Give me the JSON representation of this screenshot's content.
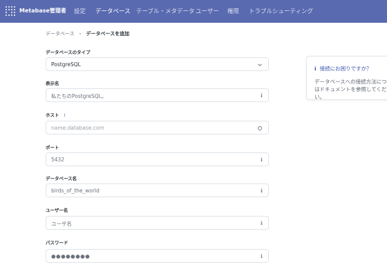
{
  "nav": {
    "brand": "Metabase管理者",
    "items": [
      "設定",
      "データベース",
      "テーブル・メタデータ",
      "ユーザー",
      "権限",
      "トラブルシューティング"
    ]
  },
  "breadcrumb": {
    "parent": "データベース",
    "separator": "›",
    "current": "データベースを追加"
  },
  "form": {
    "db_type": {
      "label": "データベースのタイプ",
      "value": "PostgreSQL"
    },
    "display_name": {
      "label": "表示名",
      "value": "私たちのPostgreSQL。"
    },
    "host": {
      "label": "ホスト",
      "info": "i",
      "placeholder": "name.database.com"
    },
    "port": {
      "label": "ポート",
      "value": "5432"
    },
    "db_name": {
      "label": "データベース名",
      "value": "birds_of_the_world"
    },
    "username": {
      "label": "ユーザー名",
      "value": "ユーザ名"
    },
    "password": {
      "label": "パスワード",
      "value": "●●●●●●●●"
    }
  },
  "help": {
    "title": "接続にお困りですか？",
    "text": "データベースへの接続方法についてはドキュメントを参照してください。"
  },
  "icons": [
    "logo-icon",
    "chevron-down-icon",
    "info-icon",
    "circle-icon"
  ]
}
